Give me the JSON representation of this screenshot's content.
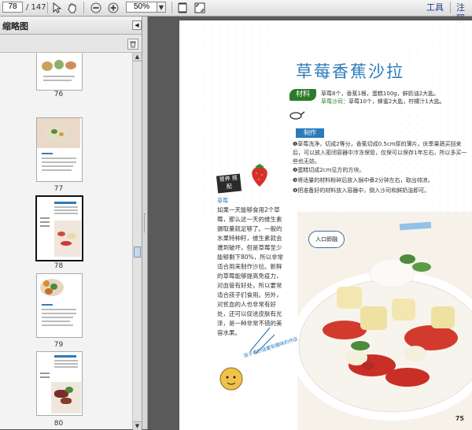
{
  "toolbar": {
    "page_current": "78",
    "page_total": "/ 147",
    "zoom": "50%",
    "tools_menu": "工具",
    "comment_menu": "注释"
  },
  "sidebar": {
    "title": "缩略图",
    "thumbnails": [
      {
        "label": "76"
      },
      {
        "label": "77"
      },
      {
        "label": "78",
        "selected": true
      },
      {
        "label": "79"
      },
      {
        "label": "80"
      }
    ]
  },
  "page": {
    "title": "草莓香蕉沙拉",
    "ingredients_label": "材料",
    "ingredients_line1": "草莓8个，香蕉1根，蛋糕100g，鲜奶油2大匙。",
    "ingredients_line2_label": "草莓沙司：",
    "ingredients_line2": "草莓10个，蜂蜜2大匙，柠檬汁1大匙。",
    "method_label": "制作",
    "steps": [
      "❶草莓洗净，切成2等分，香蕉切成0.5cm厚的薄片。庆季果蔬买回来后，可以放入密闭容器中冷冻保管，仅保可以保存1年左右，所以多买一些也无妨。",
      "❷蛋糕切成2cm见方的方块。",
      "❸将适量的材料粉碎后放入锅中煮2分钟左右，取出待凉。",
      "❹把准备好的材料放入容器中，倒入沙司和鲜奶油即可。"
    ],
    "side_label": "营养\n搭配",
    "side_sub": "草莓",
    "side_text": "如果一天能够食用2个草莓，那么这一天的维生素摄取量就足够了。一般的水果特种籽，维生素就会遭到破坏，但是草莓至少能够剩下80%，所以非常适合用来制作沙拉。新鲜的草莓能够提高免疫力，对血管有好处，所以要常适合孩子们食用。另外，对贫血的人也非常有好处，还可以促进皮肤有光泽，是一种非常不错的美容水果。",
    "photo_bubble": "入口即融",
    "note": "孩子看的话要有趣味的作品",
    "page_number": "75"
  },
  "colors": {
    "title_blue": "#2c7ab8",
    "ingredients_green": "#2c7a2c"
  }
}
